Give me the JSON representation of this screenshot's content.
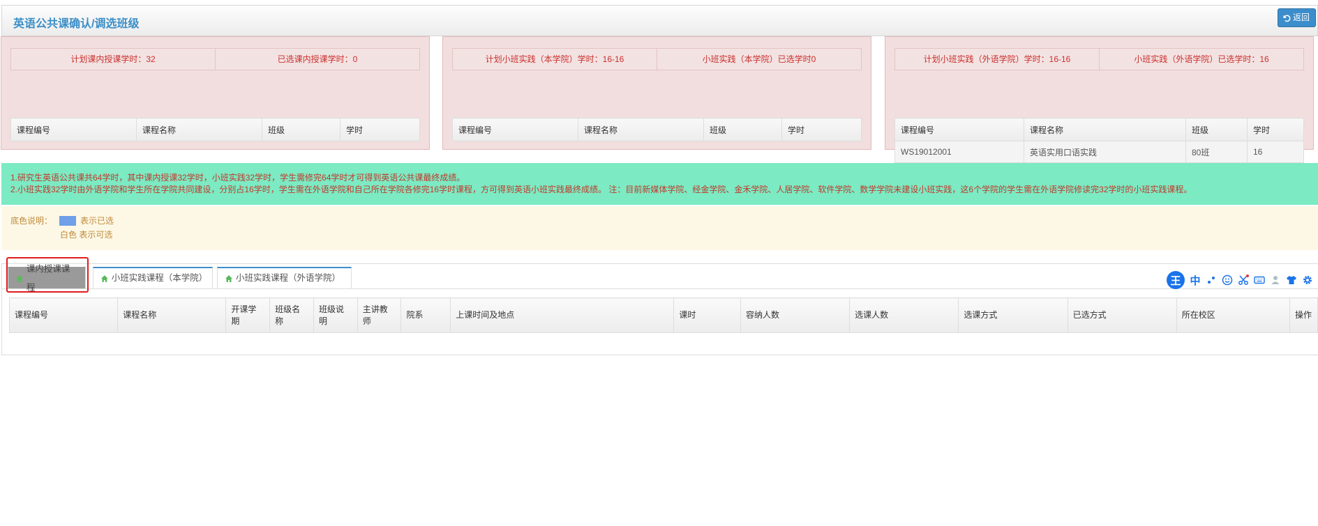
{
  "header": {
    "title": "英语公共课确认/调选班级",
    "back_label": "返回"
  },
  "panels": [
    {
      "summary_left": "计划课内授课学时：32",
      "summary_right": "已选课内授课学时：0",
      "columns": [
        "课程编号",
        "课程名称",
        "班级",
        "学时"
      ],
      "rows": []
    },
    {
      "summary_left": "计划小班实践（本学院）学时：16-16",
      "summary_right": "小班实践（本学院）已选学时0",
      "columns": [
        "课程编号",
        "课程名称",
        "班级",
        "学时"
      ],
      "rows": []
    },
    {
      "summary_left": "计划小班实践（外语学院）学时：16-16",
      "summary_right": "小班实践（外语学院）已选学时：16",
      "columns": [
        "课程编号",
        "课程名称",
        "班级",
        "学时"
      ],
      "rows": [
        [
          "WS19012001",
          "英语实用口语实践",
          "80班",
          "16"
        ]
      ]
    }
  ],
  "notice": {
    "line1": "1.研究生英语公共课共64学时，其中课内授课32学时，小班实践32学时，学生需修完64学时才可得到英语公共课最终成绩。",
    "line2": "2.小班实践32学时由外语学院和学生所在学院共同建设，分别占16学时，学生需在外语学院和自己所在学院各修完16学时课程，方可得到英语小班实践最终成绩。 注：目前新媒体学院、经金学院、金禾学院、人居学院、软件学院、数学学院未建设小班实践，这6个学院的学生需在外语学院修读完32学时的小班实践课程。"
  },
  "legend": {
    "title": "底色说明：",
    "selected_text": "表示已选",
    "white_text": "白色 表示可选",
    "selected_color": "#6e9fe8"
  },
  "tabs": [
    {
      "label": "课内授课课程",
      "active": true
    },
    {
      "label": "小班实践课程（本学院）",
      "active": false
    },
    {
      "label": "小班实践课程（外语学院）",
      "active": false
    }
  ],
  "ime": {
    "logo": "王",
    "lang": "中"
  },
  "main_table": {
    "columns": [
      "课程编号",
      "课程名称",
      "开课学期",
      "班级名称",
      "班级说明",
      "主讲教师",
      "院系",
      "上课时间及地点",
      "课时",
      "容纳人数",
      "选课人数",
      "选课方式",
      "已选方式",
      "所在校区",
      "操作"
    ]
  },
  "colors": {
    "accent": "#3c8dcb",
    "panel_bg": "#f2dede",
    "notice_bg": "#7ceac3",
    "legend_bg": "#fdf8e6",
    "alert_text": "#c9302c"
  }
}
